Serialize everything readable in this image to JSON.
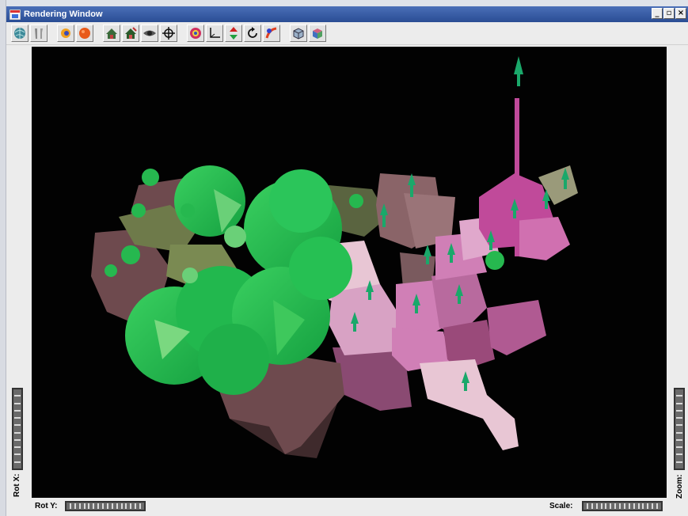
{
  "window": {
    "title": "Rendering Window",
    "minimize": "_",
    "maximize": "▫",
    "close": "×"
  },
  "toolbar": {
    "buttons": [
      {
        "name": "globe-icon"
      },
      {
        "name": "tools-icon"
      },
      {
        "name": "brightness-icon"
      },
      {
        "name": "color-ball-icon"
      },
      {
        "name": "house-view-icon"
      },
      {
        "name": "house-edit-icon"
      },
      {
        "name": "eye-icon"
      },
      {
        "name": "move-crosshair-icon"
      },
      {
        "name": "target-icon"
      },
      {
        "name": "axes-icon"
      },
      {
        "name": "arrow-up-down-icon"
      },
      {
        "name": "rotate-icon"
      },
      {
        "name": "color-map-icon"
      },
      {
        "name": "cube-wire-icon"
      },
      {
        "name": "cube-solid-icon"
      }
    ]
  },
  "controls": {
    "rot_x_label": "Rot X:",
    "rot_y_label": "Rot Y:",
    "scale_label": "Scale:",
    "zoom_label": "Zoom:"
  },
  "colors": {
    "viewport_bg": "#020202",
    "green_cones": "#1fb84a",
    "pink_states": "#c06aa8",
    "brown_states": "#6e4a4e",
    "olive_states": "#6e7a4a"
  }
}
